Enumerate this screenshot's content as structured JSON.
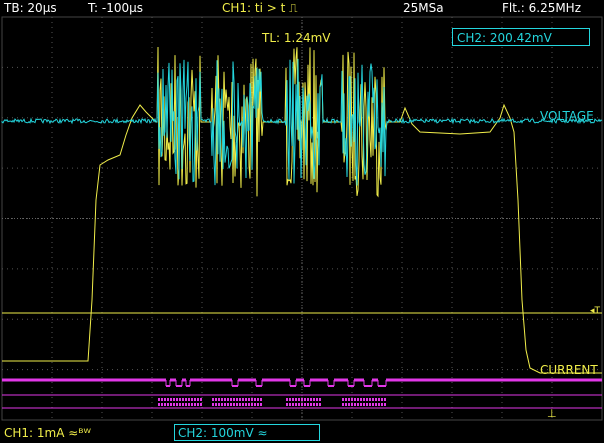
{
  "status": {
    "timebase": "TB: 20µs",
    "trigger_time": "T: -100µs",
    "trigger_condition": "CH1: ti > t ⎍",
    "sample_rate": "25MSa",
    "filter": "Flt.: 6.25MHz"
  },
  "overlays": {
    "trigger_level": "TL:  1.24mV",
    "ch2_measurement": "CH2: 200.42mV"
  },
  "labels": {
    "voltage": "VOLTAGE",
    "current": "CURRENT"
  },
  "markers": {
    "trigger": "◂T",
    "ground": "⊥"
  },
  "channels": {
    "ch1": "CH1: 1mA ≈ᴮᵂ",
    "ch2": "CH2: 100mV ≈"
  },
  "colors": {
    "ch1": "#f1ee4a",
    "ch2": "#24d6de",
    "digital": "#e238e8",
    "grid": "#555555"
  },
  "icons": [
    "trigger-level-marker-icon",
    "ground-marker-icon"
  ]
}
